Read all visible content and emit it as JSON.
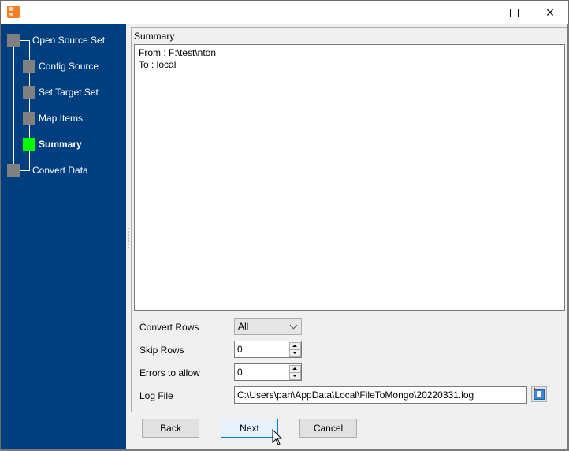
{
  "window": {
    "title": "",
    "controls": {
      "minimize": "minimize",
      "maximize": "maximize",
      "close": "×"
    }
  },
  "sidebar": {
    "background_color": "#003f7f",
    "steps": [
      {
        "label": "Open Source Set",
        "level": 0,
        "active": false
      },
      {
        "label": "Config Source",
        "level": 1,
        "active": false
      },
      {
        "label": "Set Target Set",
        "level": 1,
        "active": false
      },
      {
        "label": "Map Items",
        "level": 1,
        "active": false
      },
      {
        "label": "Summary",
        "level": 1,
        "active": true
      },
      {
        "label": "Convert Data",
        "level": 0,
        "active": false
      }
    ],
    "active_color": "#00ff00",
    "inactive_color": "#808080"
  },
  "summary": {
    "title": "Summary",
    "lines": [
      "From : F:\\test\\nton",
      "To : local"
    ]
  },
  "form": {
    "convert_rows": {
      "label": "Convert Rows",
      "value": "All"
    },
    "skip_rows": {
      "label": "Skip Rows",
      "value": "0"
    },
    "errors_to_allow": {
      "label": "Errors to allow",
      "value": "0"
    },
    "log_file": {
      "label": "Log File",
      "value": "C:\\Users\\pan\\AppData\\Local\\FileToMongo\\20220331.log"
    }
  },
  "buttons": {
    "back": "Back",
    "next": "Next",
    "cancel": "Cancel"
  }
}
